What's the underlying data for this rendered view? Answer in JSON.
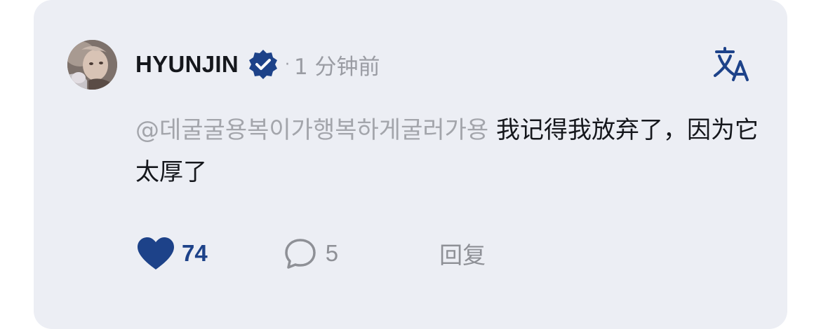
{
  "comment": {
    "username": "HYUNJIN",
    "time_separator": "·",
    "time": "1 分钟前",
    "mention": "@데굴굴용복이가행복하게굴러가용",
    "text": "我记得我放弃了，因为它太厚了",
    "likes": "74",
    "comments": "5",
    "reply_label": "回复"
  },
  "icons": {
    "avatar": "user-avatar",
    "verified": "verified-badge-icon",
    "translate": "translate-icon",
    "like": "heart-icon",
    "comment": "comment-bubble-icon"
  },
  "colors": {
    "card_background": "#eceef4",
    "accent_blue": "#1d4289",
    "muted_text": "#9a9ca3",
    "primary_text": "#15171c"
  }
}
